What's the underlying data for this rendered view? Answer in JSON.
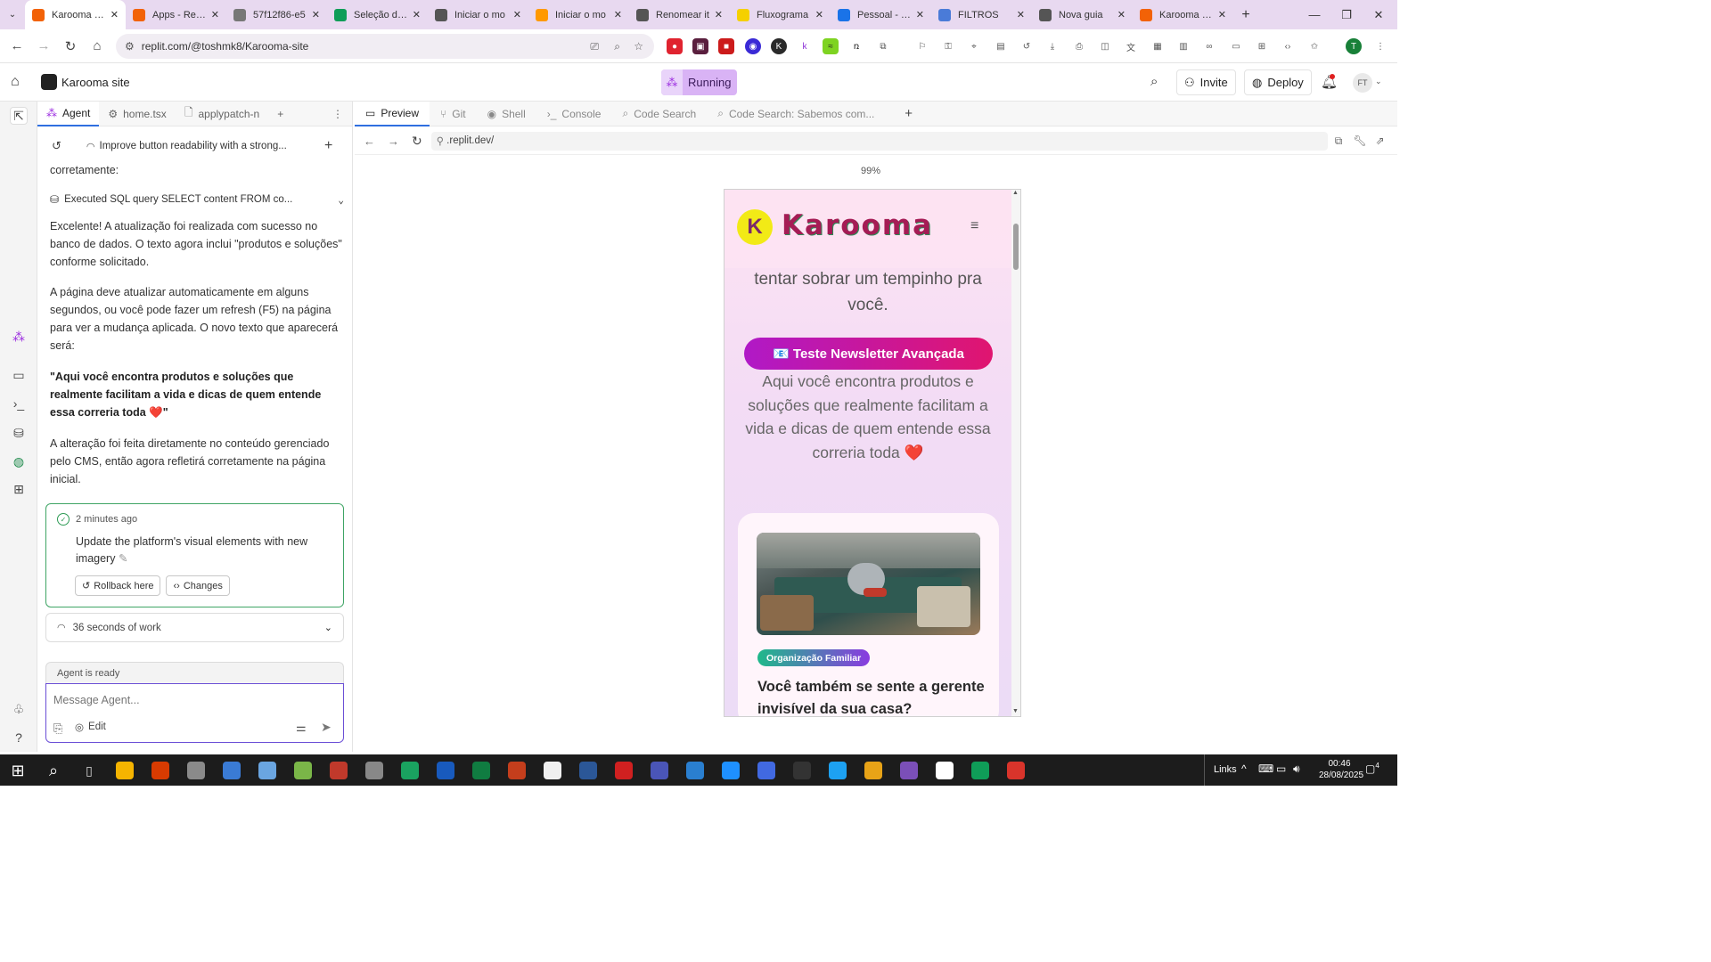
{
  "browser": {
    "tabs": [
      {
        "label": "Karooma site",
        "color": "#f26207",
        "active": true
      },
      {
        "label": "Apps - Replit",
        "color": "#f26207"
      },
      {
        "label": "57f12f86-e5",
        "color": "#777777"
      },
      {
        "label": "Seleção de P",
        "color": "#0f9d58"
      },
      {
        "label": "Iniciar o mo",
        "color": "#555555"
      },
      {
        "label": "Iniciar o mo",
        "color": "#ff9900"
      },
      {
        "label": "Renomear it",
        "color": "#555555"
      },
      {
        "label": "Fluxograma",
        "color": "#f5d000"
      },
      {
        "label": "Pessoal - Go",
        "color": "#1a73e8"
      },
      {
        "label": "FILTROS",
        "color": "#4a7bd8"
      },
      {
        "label": "Nova guia",
        "color": "#555555"
      },
      {
        "label": "Karooma site",
        "color": "#f26207"
      }
    ],
    "url": "replit.com/@toshmk8/Karooma-site",
    "profile_initial": "T"
  },
  "replit": {
    "project_name": "Karooma site",
    "run_status": "Running",
    "invite_label": "Invite",
    "deploy_label": "Deploy",
    "user_initials": "FT",
    "panel_tabs": [
      "Agent",
      "home.tsx",
      "applypatch-n"
    ],
    "checkpoint_title": "Improve button readability with a strong...",
    "messages": {
      "cut_line": "corretamente:",
      "sql": "Executed SQL query SELECT content FROM co...",
      "p1": "Excelente! A atualização foi realizada com sucesso no banco de dados. O texto agora inclui \"produtos e soluções\" conforme solicitado.",
      "p2": "A página deve atualizar automaticamente em alguns segundos, ou você pode fazer um refresh (F5) na página para ver a mudança aplicada. O novo texto que aparecerá será:",
      "quote": "\"Aqui você encontra produtos e soluções que realmente facilitam a vida e dicas de quem entende essa correria toda ❤️\"",
      "p3": "A alteração foi feita diretamente no conteúdo gerenciado pelo CMS, então agora refletirá corretamente na página inicial."
    },
    "checkpoint_card": {
      "time": "2 minutes ago",
      "title": "Update the platform's visual elements with new imagery",
      "rollback_label": "Rollback here",
      "changes_label": "Changes"
    },
    "work_summary": "36 seconds of work",
    "agent_status": "Agent is ready",
    "input_placeholder": "Message Agent...",
    "edit_label": "Edit",
    "view_tabs": [
      "Preview",
      "Git",
      "Shell",
      "Console",
      "Code Search",
      "Code Search: Sabemos com..."
    ],
    "preview_url": ".replit.dev/",
    "zoom": "99%"
  },
  "site": {
    "brand": "Karooma",
    "hero_tail": "tentar sobrar um tempinho pra você.",
    "cta_label": "📧 Teste Newsletter Avançada",
    "intro": "Aqui você encontra produtos e soluções que realmente facilitam a vida e dicas de quem entende essa correria toda ❤️",
    "card_tag": "Organização Familiar",
    "card_title": "Você também se sente a gerente invisível da sua casa?"
  },
  "taskbar": {
    "links_label": "Links",
    "time": "00:46",
    "date": "28/08/2025",
    "notif_count": "4"
  }
}
